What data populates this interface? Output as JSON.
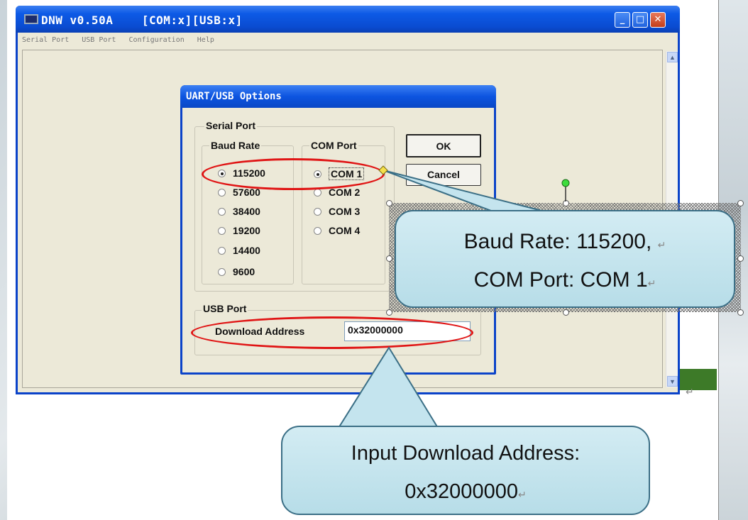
{
  "window": {
    "title": "DNW v0.50A    [COM:x][USB:x]",
    "menu": [
      "Serial Port",
      "USB Port",
      "Configuration",
      "Help"
    ],
    "minimize_glyph": "_",
    "maximize_glyph": "□",
    "close_glyph": "✕"
  },
  "dialog": {
    "title": "UART/USB Options",
    "serial_group_label": "Serial Port",
    "baud_group_label": "Baud Rate",
    "baud_rates": [
      "115200",
      "57600",
      "38400",
      "19200",
      "14400",
      "9600"
    ],
    "baud_selected": "115200",
    "com_group_label": "COM Port",
    "com_ports": [
      "COM 1",
      "COM 2",
      "COM 3",
      "COM 4"
    ],
    "com_selected": "COM 1",
    "ok_label": "OK",
    "cancel_label": "Cancel",
    "usb_group_label": "USB Port",
    "download_address_label": "Download Address",
    "download_address_value": "0x32000000"
  },
  "callouts": {
    "serial_line1": "Baud Rate: 115200,",
    "serial_line2": "COM Port: COM 1",
    "download_line1": "Input Download Address:",
    "download_line2": "0x32000000"
  },
  "marks": {
    "paragraph": "↵"
  },
  "colors": {
    "xp_blue": "#0b43c9",
    "highlight_red": "#e01515",
    "callout_fill": "#c4e4ee"
  },
  "icons": [
    "app-icon",
    "minimize-icon",
    "maximize-icon",
    "close-icon",
    "scroll-up-icon",
    "scroll-down-icon",
    "radio-icon"
  ]
}
